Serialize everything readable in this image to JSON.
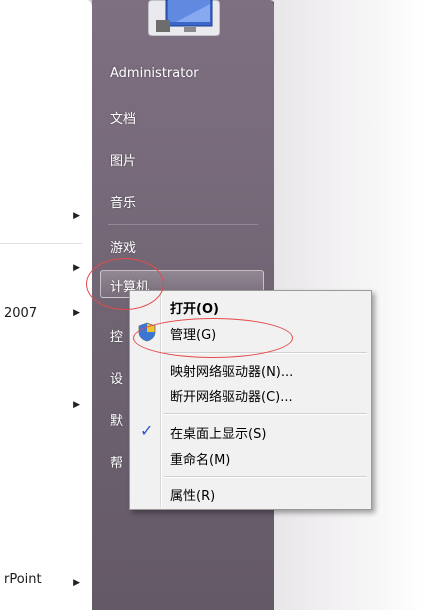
{
  "left_pane": {
    "items": [
      {
        "label": "",
        "has_arrow": true
      },
      {
        "label": "",
        "has_arrow": true
      },
      {
        "label": "2007",
        "has_arrow": true
      },
      {
        "label": "",
        "has_arrow": true
      },
      {
        "label": "rPoint",
        "has_arrow": true
      }
    ]
  },
  "right_pane": {
    "user": "Administrator",
    "documents": "文档",
    "pictures": "图片",
    "music": "音乐",
    "games": "游戏",
    "computer": "计算机",
    "control_panel_partial": "控",
    "devices_partial": "设",
    "defaults_partial": "默",
    "help_partial": "帮"
  },
  "context_menu": {
    "open": "打开(O)",
    "manage": "管理(G)",
    "map_drive": "映射网络驱动器(N)...",
    "disconnect_drive": "断开网络驱动器(C)...",
    "show_on_desktop": "在桌面上显示(S)",
    "rename": "重命名(M)",
    "properties": "属性(R)"
  },
  "colors": {
    "pane_purple": "#776a7a",
    "annotation_red": "#e34a4a",
    "check_blue": "#2a55c8"
  },
  "icons": {
    "avatar": "user-avatar-icon",
    "shield": "uac-shield-icon",
    "check": "checkmark-icon",
    "arrow": "triangle-right-icon"
  }
}
